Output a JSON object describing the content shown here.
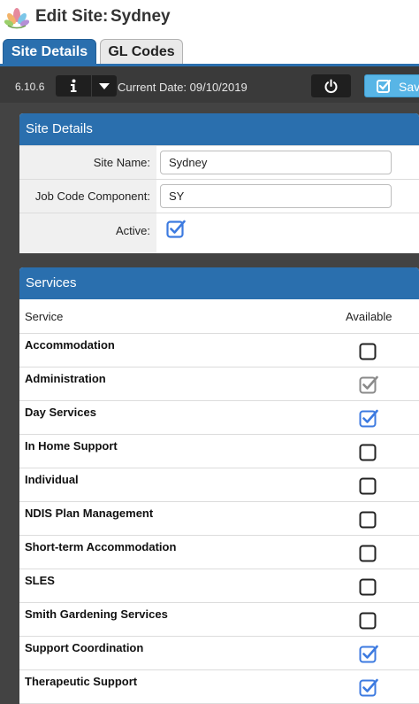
{
  "app": {
    "title_prefix": "Edit Site:",
    "site_name": "Sydney",
    "logo_icon": "lotus-logo-icon"
  },
  "tabs": [
    {
      "label": "Site Details",
      "active": true
    },
    {
      "label": "GL Codes",
      "active": false
    }
  ],
  "toolbar": {
    "version": "6.10.6",
    "info_icon": "info-icon",
    "dropdown_icon": "caret-down-icon",
    "current_date": "Current Date: 09/10/2019",
    "power_icon": "power-icon",
    "save_label": "Save",
    "save_icon": "checkbox-icon"
  },
  "site_details": {
    "header": "Site Details",
    "site_name_label": "Site Name:",
    "site_name_value": "Sydney",
    "job_code_label": "Job Code Component:",
    "job_code_value": "SY",
    "active_label": "Active:",
    "active_checked": true
  },
  "services": {
    "header": "Services",
    "col_service": "Service",
    "col_available": "Available",
    "rows": [
      {
        "name": "Accommodation",
        "available": false,
        "disabled": false
      },
      {
        "name": "Administration",
        "available": true,
        "disabled": true
      },
      {
        "name": "Day Services",
        "available": true,
        "disabled": false
      },
      {
        "name": "In Home Support",
        "available": false,
        "disabled": false
      },
      {
        "name": "Individual",
        "available": false,
        "disabled": false
      },
      {
        "name": "NDIS Plan Management",
        "available": false,
        "disabled": false
      },
      {
        "name": "Short-term Accommodation",
        "available": false,
        "disabled": false
      },
      {
        "name": "SLES",
        "available": false,
        "disabled": false
      },
      {
        "name": "Smith Gardening Services",
        "available": false,
        "disabled": false
      },
      {
        "name": "Support Coordination",
        "available": true,
        "disabled": false
      },
      {
        "name": "Therapeutic Support",
        "available": true,
        "disabled": false
      }
    ]
  },
  "colors": {
    "accent_blue": "#2a6fae",
    "checked_blue": "#3c7ae0",
    "disabled_gray": "#8a8a8a",
    "toolbar_bg": "#3a3a3a",
    "save_bg": "#58b5e6"
  }
}
